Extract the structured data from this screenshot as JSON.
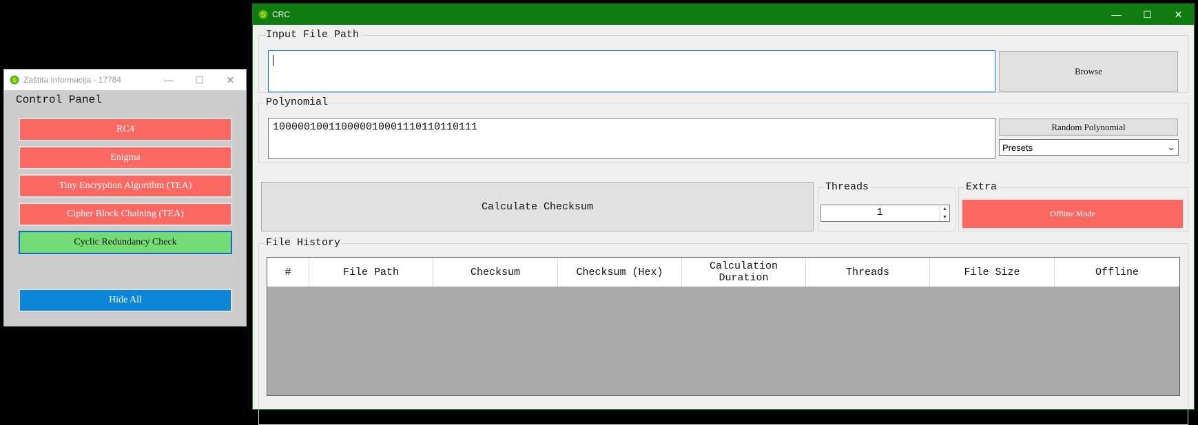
{
  "control_panel": {
    "window_title": "Zaštita Informacija - 17784",
    "group_label": "Control Panel",
    "buttons": {
      "rc4": "RC4",
      "enigma": "Enigma",
      "tea": "Tiny Encryption Algorithm (TEA)",
      "cbc": "Cipher Block Chaining (TEA)",
      "crc": "Cyclic Redundancy Check",
      "hide_all": "Hide All"
    }
  },
  "crc": {
    "window_title": "CRC",
    "input_group_label": "Input File Path",
    "input_value": "",
    "browse_label": "Browse",
    "polynomial_group_label": "Polynomial",
    "polynomial_value": "100000100110000010001110110110111",
    "random_polynomial_label": "Random Polynomial",
    "presets_value": "Presets",
    "calculate_label": "Calculate Checksum",
    "threads_group_label": "Threads",
    "threads_value": "1",
    "extra_group_label": "Extra",
    "offline_mode_label": "Offline Mode",
    "history_group_label": "File History",
    "table_columns": [
      "#",
      "File Path",
      "Checksum",
      "Checksum (Hex)",
      "Calculation Duration",
      "Threads",
      "File Size",
      "Offline"
    ],
    "table_rows": []
  },
  "window_controls": {
    "minimize": "—",
    "maximize": "☐",
    "close": "✕"
  },
  "colors": {
    "crc_titlebar": "#0f7b10",
    "red_button": "#fc6862",
    "green_button": "#74dc74",
    "blue_button": "#0b86d8"
  }
}
